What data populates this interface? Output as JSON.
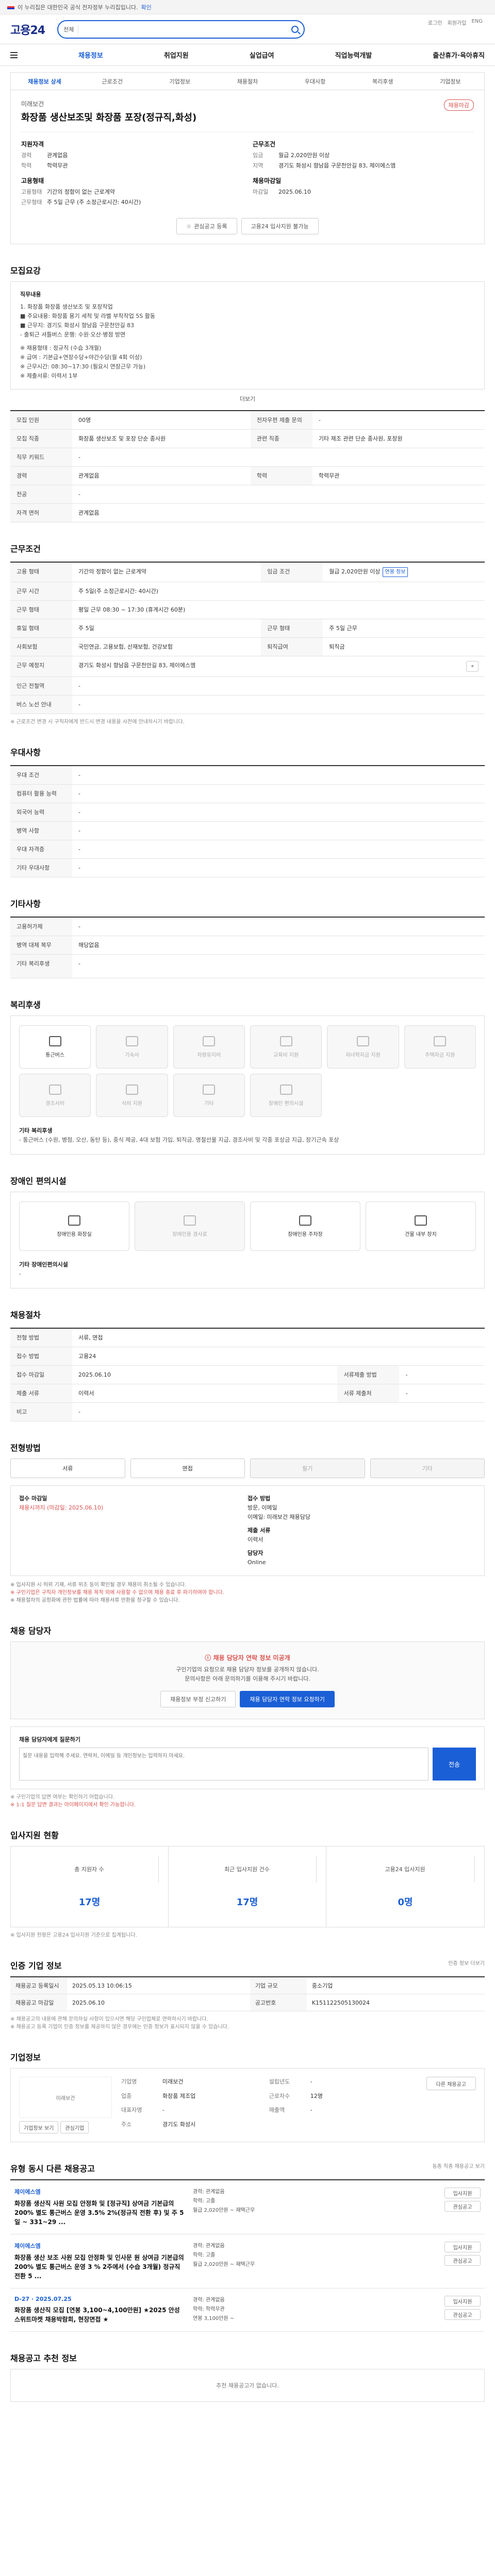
{
  "topbar": {
    "text": "이 누리집은 대한민국 공식 전자정부 누리집입니다.",
    "more": "확인"
  },
  "header": {
    "logo": "고용24",
    "search_category": "전체"
  },
  "util": [
    "로그인",
    "회원가입",
    "ENG"
  ],
  "gnb": [
    "채용정보",
    "취업지원",
    "실업급여",
    "직업능력개발",
    "출산휴가·육아휴직"
  ],
  "tabs": [
    "채용정보 상세",
    "근로조건",
    "기업정보",
    "채용절차",
    "우대사항",
    "복리후생",
    "기업정보"
  ],
  "job": {
    "company": "미래보건",
    "status_badge": "채용마감",
    "title": "화장품 생산보조및 화장품 포장(정규직,화성)",
    "left_heading": "지원자격",
    "left_rows": [
      {
        "k": "경력",
        "v": "관계없음"
      },
      {
        "k": "학력",
        "v": "학력무관"
      }
    ],
    "left_heading2": "고용형태",
    "left_rows2": [
      {
        "k": "고용형태",
        "v": "기간의 정함이 없는 근로계약"
      },
      {
        "k": "근무형태",
        "v": "주 5일 근무 (주 소정근로시간: 40시간)"
      }
    ],
    "right_heading": "근무조건",
    "right_rows": [
      {
        "k": "임금",
        "v": "월급 2,020만원 이상"
      },
      {
        "k": "지역",
        "v": "경기도 화성시 향남읍 구문천안길 83, 제이에스엠"
      }
    ],
    "right_heading2": "채용마감일",
    "right_rows2": [
      {
        "k": "마감일",
        "v": "2025.06.10"
      }
    ],
    "btn_interest": "관심공고 등록",
    "btn_apply": "고용24 입사지원 불가능"
  },
  "sections": {
    "detail": "모집요강",
    "work": "근무조건",
    "pref": "우대사항",
    "others": "기타사항",
    "welfare": "복리후생",
    "disabled": "장애인 편의시설",
    "process": "채용절차",
    "method": "전형방법",
    "report": "채용 담당자",
    "status": "입사지원 현황",
    "info": "인증 기업 정보",
    "company": "기업정보",
    "similar": "유형 동시 다른 채용공고",
    "recommend": "채용공고 추천 정보"
  },
  "detail": {
    "sub": "직무내용",
    "lines": [
      "1. 화장품 화장품 생산보조 및 포장작업",
      "■ 주요내용: 화장품 용기 세척 및 라벨 부착작업 5S 활동",
      "■ 근무지: 경기도 화성시 향남읍 구문천안길 83",
      "- 출퇴근 셔틀버스 운행: 수원·오산·병점 방면",
      "※ 채용형태 : 정규직 (수습 3개월)",
      "※ 급여 : 기본급+연장수당+야간수당(월 4회 이상)",
      "※ 근무시간: 08:30~17:30 (필요시 연장근무 가능)",
      "※ 제출서류: 이력서 1부"
    ],
    "more": "더보기"
  },
  "table1": [
    {
      "k": "모집 인원",
      "v": "00명",
      "k2": "전자우편 제출 문의",
      "v2": "-"
    },
    {
      "k": "모집 직종",
      "v": "화장품 생산보조 및 포장 단순 종사원",
      "k2": "관련 직종",
      "v2": "기타 제조 관련 단순 종사원, 포장원"
    },
    {
      "k": "직무 키워드",
      "v": "-",
      "k2": "",
      "v2": ""
    },
    {
      "k": "경력",
      "v": "관계없음",
      "k2": "학력",
      "v2": "학력무관"
    },
    {
      "k": "전공",
      "v": "-",
      "k2": "",
      "v2": ""
    },
    {
      "k": "자격 면허",
      "v": "관계없음",
      "k2": "",
      "v2": ""
    }
  ],
  "table2": [
    {
      "k": "고용 형태",
      "v": "기간의 정함이 없는 근로계약",
      "k2": "임금 조건",
      "v2": "월급 2,020만원 이상"
    },
    {
      "k": "근무 시간",
      "v": "주 5일(주 소정근로시간: 40시간)",
      "k2": "",
      "v2": ""
    },
    {
      "k": "근무 형태",
      "v": "평일 근무 08:30 ~ 17:30 (휴게시간 60분)",
      "k2": "",
      "v2": ""
    },
    {
      "k": "휴일 형태",
      "v": "주 5일",
      "k2": "근무 형태",
      "v2": "주 5일 근무"
    },
    {
      "k": "사회보험",
      "v": "국민연금, 고용보험, 산재보험, 건강보험",
      "k2": "퇴직급여",
      "v2": "퇴직금"
    },
    {
      "k": "근무 예정지",
      "v": "경기도 화성시 향남읍 구문천안길 83, 제이에스엠",
      "k2": "",
      "v2": ""
    },
    {
      "k": "인근 전철역",
      "v": "-",
      "k2": "",
      "v2": ""
    },
    {
      "k": "버스 노선 안내",
      "v": "-",
      "k2": "",
      "v2": ""
    }
  ],
  "wage_tag": "연봉 정보",
  "table2_note": "※ 근로조건 변경 시 구직자에게 반드시 변경 내용을 사전에 안내하시기 바랍니다.",
  "pref": [
    {
      "k": "우대 조건",
      "v": "-"
    },
    {
      "k": "컴퓨터 활용 능력",
      "v": "-"
    },
    {
      "k": "외국어 능력",
      "v": "-"
    },
    {
      "k": "병역 사항",
      "v": "-"
    },
    {
      "k": "우대 자격증",
      "v": "-"
    },
    {
      "k": "기타 우대사항",
      "v": "-"
    }
  ],
  "others": [
    {
      "k": "고용허가제",
      "v": "-"
    },
    {
      "k": "병역 대체 복무",
      "v": "해당없음"
    },
    {
      "k": "기타 복리후생",
      "v": "-"
    }
  ],
  "welfare_items": [
    {
      "label": "통근버스",
      "on": true
    },
    {
      "label": "기숙사",
      "on": false
    },
    {
      "label": "차량유지비",
      "on": false
    },
    {
      "label": "교육비 지원",
      "on": false
    },
    {
      "label": "자녀학자금 지원",
      "on": false
    },
    {
      "label": "주택자금 지원",
      "on": false
    },
    {
      "label": "경조사비",
      "on": false
    },
    {
      "label": "식비 지원",
      "on": false
    },
    {
      "label": "기타",
      "on": false
    },
    {
      "label": "장애인 편의시설",
      "on": false
    }
  ],
  "welfare_text_title": "기타 복리후생",
  "welfare_text": "- 통근버스 (수원, 병점, 오산, 동탄 등), 중식 제공, 4대 보험 가입, 퇴직금, 명절선물 지급, 경조사비 및 각종 포상금 지급, 장기근속 포상",
  "disabled_items": [
    "장애인용 화장실",
    "장애인용 경사로",
    "장애인용 주차장",
    "건물 내부 장치"
  ],
  "disabled_text_title": "기타 장애인편의시설",
  "disabled_text": "-",
  "process": [
    {
      "k": "전형 방법",
      "v": "서류, 면접"
    },
    {
      "k": "접수 방법",
      "v": "고용24"
    },
    {
      "k": "접수 마감일",
      "v": "2025.06.10",
      "k2": "서류제출 방법",
      "v2": "-"
    },
    {
      "k": "제출 서류",
      "v": "이력서",
      "k2": "서류 제출처",
      "v2": "-"
    },
    {
      "k": "비고",
      "v": "-",
      "k2": "",
      "v2": ""
    }
  ],
  "method_buttons": [
    {
      "label": "서류",
      "on": true
    },
    {
      "label": "면접",
      "on": true
    },
    {
      "label": "필기",
      "on": false
    },
    {
      "label": "기타",
      "on": false
    }
  ],
  "contact": {
    "k1": "접수 마감일",
    "v1": "채용시까지 (마감일: 2025.06.10)",
    "k2": "접수 방법",
    "v2": "방문, 이메일",
    "v2b": "이메일: 미래보건 채용담당",
    "k3": "제출 서류",
    "v3": "이력서",
    "k4": "담당자",
    "v4": "Online"
  },
  "method_warn": [
    "※ 입사지원 시 허위 기재, 서류 위조 등이 확인될 경우 채용이 취소될 수 있습니다.",
    "※ 구인기업은 구직자 개인정보를 채용 목적 외에 사용할 수 없으며 채용 종료 후 파기하여야 합니다.",
    "※ 채용절차의 공정화에 관한 법률에 따라 채용서류 반환을 청구할 수 있습니다."
  ],
  "report": {
    "title": "채용 담당자 연락 정보 미공개",
    "desc1": "구인기업의 요청으로 채용 담당자 정보를 공개하지 않습니다.",
    "desc2": "문의사항은 아래 문의하기를 이용해 주시기 바랍니다.",
    "btn1": "채용정보 부정 신고하기",
    "btn2": "채용 담당자 연락 정보 요청하기",
    "q_label": "채용 담당자에게 질문하기",
    "q_placeholder": "질문 내용을 입력해 주세요. 연락처, 이메일 등 개인정보는 입력하지 마세요.",
    "q_send": "전송",
    "q_notes": [
      "※ 구인기업의 답변 여부는 확인하기 어렵습니다.",
      "※ 1:1 질문 답변 결과는 마이페이지에서 확인 가능합니다."
    ]
  },
  "status": [
    {
      "label": "총 지원자 수",
      "num": "17명"
    },
    {
      "label": "최근 입사지원 건수",
      "num": "17명"
    },
    {
      "label": "고용24 입사지원",
      "num": "0명"
    }
  ],
  "status_note": "※ 입사지원 현황은 고용24 입사지원 기준으로 집계됩니다.",
  "info_right": "인증 정보 더보기",
  "info_table": [
    {
      "k": "채용공고 등록일시",
      "v": "2025.05.13 10:06:15",
      "k2": "기업 규모",
      "v2": "중소기업"
    },
    {
      "k": "채용공고 마감일",
      "v": "2025.06.10",
      "k2": "공고번호",
      "v2": "K151122505130024"
    }
  ],
  "info_notes": [
    "※ 채용공고의 내용에 관해 문의하실 사항이 있으시면 해당 구인업체로 연락하시기 바랍니다.",
    "※ 채용공고 등록 기업이 인증 정보를 제공하지 않은 경우에는 인증 정보가 표시되지 않을 수 있습니다."
  ],
  "company": {
    "logo_text": "미래보건",
    "rows": [
      {
        "k": "기업명",
        "v": "미래보건",
        "k2": "설립년도",
        "v2": "-"
      },
      {
        "k": "업종",
        "v": "화장품 제조업",
        "k2": "근로자수",
        "v2": "12명"
      },
      {
        "k": "대표자명",
        "v": "-",
        "k2": "매출액",
        "v2": "-"
      },
      {
        "k": "주소",
        "v": "경기도 화성시",
        "k2": "",
        "v2": ""
      }
    ],
    "btn1": "기업정보 보기",
    "btn2": "관심기업",
    "btn3": "다른 채용공고"
  },
  "similar_right": "동종 직종 채용공고 보기",
  "similar": [
    {
      "company": "제이에스엠",
      "title": "화장품 생산직 사원 모집 안정화 및 [정규직] 상여금 기본급의 200% 별도 통근버스 운영 3.5% 2%(정규직 전환 후) 및 주 5일 ~ 331~29 ...",
      "mid": [
        "경력: 관계없음",
        "학력: 고졸",
        "월급 2,020만원 ~ 재택근무"
      ],
      "dday": "",
      "btns": [
        "입사지원",
        "관심공고"
      ]
    },
    {
      "company": "제이에스엠",
      "title": "화장품 생산 보조 사원 모집 안정화 및 인사문 원 상여금 기본급의 200% 별도 통근버스 운영 3 % 2주에서 (수습 3개월) 정규직 전환 5 ...",
      "mid": [
        "경력: 관계없음",
        "학력: 고졸",
        "월급 2,020만원 ~ 재택근무"
      ],
      "dday": "",
      "btns": [
        "입사지원",
        "관심공고"
      ]
    },
    {
      "company": "D-27 · 2025.07.25",
      "title": "화장품 생산직 모집 [연봉 3,100~4,100만원] ★2025 안성 스위트마켓 채용박람회, 현장면접 ★",
      "mid": [
        "경력: 관계없음",
        "학력: 학력무관",
        "연봉 3,100만원 ~"
      ],
      "dday": "D-27",
      "btns": [
        "입사지원",
        "관심공고"
      ]
    }
  ],
  "recommend_empty": "추천 채용공고가 없습니다."
}
